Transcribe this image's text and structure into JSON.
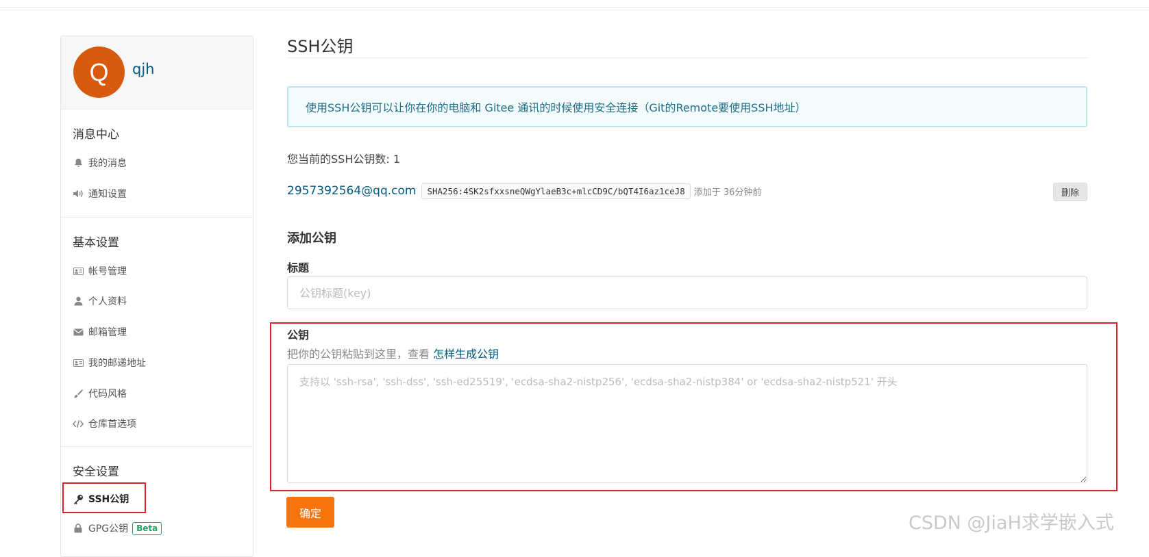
{
  "sidebar": {
    "username": "qjh",
    "avatar_letter": "Q",
    "sections": [
      {
        "title": "消息中心",
        "items": [
          "我的消息",
          "通知设置"
        ]
      },
      {
        "title": "基本设置",
        "items": [
          "帐号管理",
          "个人资料",
          "邮箱管理",
          "我的邮递地址",
          "代码风格",
          "仓库首选项"
        ]
      },
      {
        "title": "安全设置",
        "items": [
          "SSH公钥",
          "GPG公钥"
        ]
      }
    ],
    "beta_badge": "Beta"
  },
  "main": {
    "page_title": "SSH公钥",
    "info_text": "使用SSH公钥可以让你在你的电脑和 Gitee 通讯的时候使用安全连接（Git的Remote要使用SSH地址）",
    "key_count_label": "您当前的SSH公钥数: 1",
    "keys": [
      {
        "email": "2957392564@qq.com",
        "fingerprint": "SHA256:4SK2sfxxsneQWgYlaeB3c+mlcCD9C/bQT4I6az1ceJ8",
        "added": "添加于 36分钟前",
        "delete_label": "删除"
      }
    ],
    "add_title": "添加公钥",
    "title_label": "标题",
    "title_placeholder": "公钥标题(key)",
    "key_label": "公钥",
    "hint_text": "把你的公钥粘贴到这里，查看 ",
    "hint_link": "怎样生成公钥",
    "key_placeholder": "支持以 'ssh-rsa', 'ssh-dss', 'ssh-ed25519', 'ecdsa-sha2-nistp256', 'ecdsa-sha2-nistp384' or 'ecdsa-sha2-nistp521' 开头",
    "confirm_label": "确定"
  },
  "watermark": "CSDN @JiaH求学嵌入式",
  "colors": {
    "avatar_bg": "#d85a0e",
    "link": "#005980",
    "info_bg": "#f4fbfc",
    "info_border": "#bfe6ee",
    "confirm_btn": "#f7730c",
    "highlight_box": "#e0202a",
    "beta": "#21a366"
  }
}
